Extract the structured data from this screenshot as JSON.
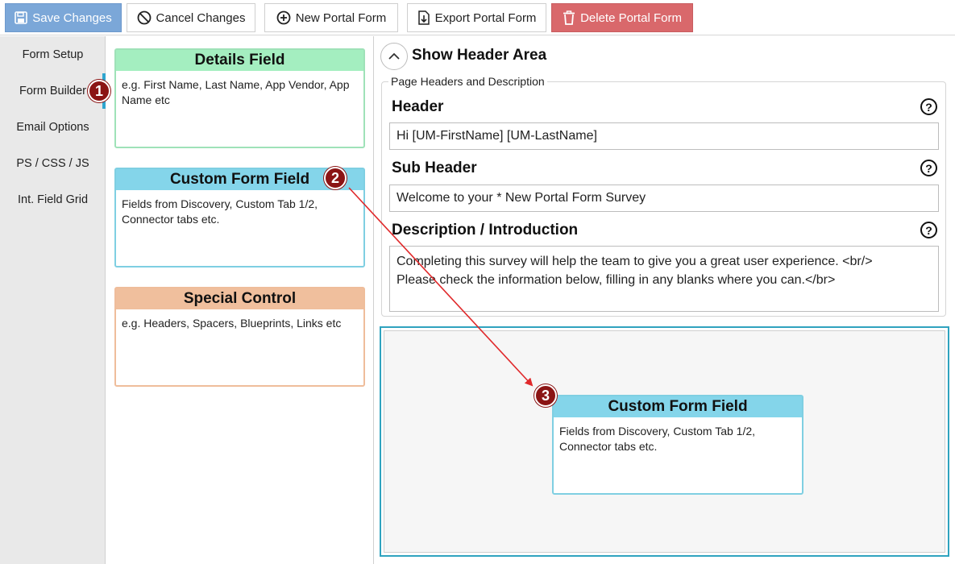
{
  "toolbar": {
    "save_label": "Save Changes",
    "cancel_label": "Cancel Changes",
    "new_label": "New Portal Form",
    "export_label": "Export Portal Form",
    "delete_label": "Delete Portal Form"
  },
  "nav": {
    "items": [
      {
        "label": "Form Setup"
      },
      {
        "label": "Form Builder"
      },
      {
        "label": "Email Options"
      },
      {
        "label": "PS / CSS / JS"
      },
      {
        "label": "Int. Field Grid"
      }
    ],
    "active_index": 1
  },
  "palette": {
    "details": {
      "title": "Details Field",
      "desc": "e.g. First Name, Last Name, App Vendor, App Name etc"
    },
    "custom": {
      "title": "Custom Form Field",
      "desc": "Fields from Discovery, Custom Tab 1/2, Connector tabs etc."
    },
    "special": {
      "title": "Special Control",
      "desc": "e.g. Headers, Spacers, Blueprints, Links etc"
    }
  },
  "main": {
    "show_header_label": "Show Header Area",
    "group_legend": "Page Headers and Description",
    "header": {
      "label": "Header",
      "value": "Hi [UM-FirstName] [UM-LastName]"
    },
    "subheader": {
      "label": "Sub Header",
      "value": "Welcome to your * New Portal Form Survey"
    },
    "description": {
      "label": "Description / Introduction",
      "value": "Completing this survey will help the team to give you a great user experience. <br/>\nPlease check the information below, filling in any blanks where you can.</br>"
    },
    "help_glyph": "?"
  },
  "dropzone": {
    "placed_field": {
      "title": "Custom Form Field",
      "desc": "Fields from Discovery, Custom Tab 1/2, Connector tabs etc."
    }
  },
  "callouts": {
    "one": "1",
    "two": "2",
    "three": "3"
  },
  "colors": {
    "save": "#7ba7d8",
    "delete": "#d9686b",
    "details": "#a4eec0",
    "custom": "#84d5ea",
    "special": "#f0bf9d",
    "accent": "#2fa6cf",
    "badge": "#8b1414",
    "arrow": "#e0292b"
  }
}
